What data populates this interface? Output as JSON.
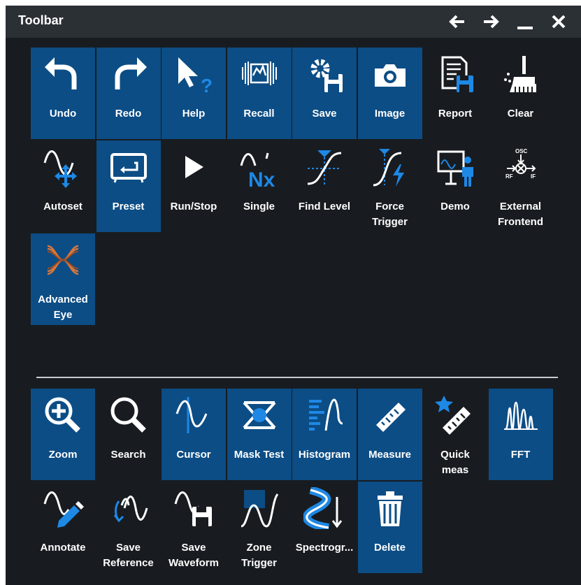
{
  "window": {
    "title": "Toolbar",
    "controls": [
      "arrow-left-icon",
      "arrow-right-icon",
      "minimize-icon",
      "close-icon"
    ]
  },
  "colors": {
    "background": "#181c20",
    "titlebar": "#2b3035",
    "selected": "#0c4d85",
    "accent": "#1e88e5",
    "text": "#ffffff"
  },
  "active_tools": [
    {
      "label": "Undo",
      "icon": "undo-icon",
      "selected": true
    },
    {
      "label": "Redo",
      "icon": "redo-icon",
      "selected": true
    },
    {
      "label": "Help",
      "icon": "help-icon",
      "selected": true
    },
    {
      "label": "Recall",
      "icon": "recall-icon",
      "selected": true
    },
    {
      "label": "Save",
      "icon": "save-settings-icon",
      "selected": true
    },
    {
      "label": "Image",
      "icon": "camera-icon",
      "selected": true
    },
    {
      "label": "Report",
      "icon": "report-icon",
      "selected": false
    },
    {
      "label": "Clear",
      "icon": "broom-icon",
      "selected": false
    },
    {
      "label": "Autoset",
      "icon": "autoset-icon",
      "selected": false
    },
    {
      "label": "Preset",
      "icon": "preset-icon",
      "selected": true
    },
    {
      "label": "Run/Stop",
      "icon": "play-icon",
      "selected": false
    },
    {
      "label": "Single",
      "icon": "single-nx-icon",
      "selected": false
    },
    {
      "label": "Find Level",
      "icon": "find-level-icon",
      "selected": false
    },
    {
      "label": "Force\nTrigger",
      "icon": "force-trigger-icon",
      "selected": false
    },
    {
      "label": "Demo",
      "icon": "demo-presenter-icon",
      "selected": false
    },
    {
      "label": "External\nFrontend",
      "icon": "mixer-icon",
      "selected": false
    },
    {
      "label": "Advanced\nEye",
      "icon": "eye-diagram-icon",
      "selected": true
    }
  ],
  "available_tools": [
    {
      "label": "Zoom",
      "icon": "zoom-in-icon",
      "selected": true
    },
    {
      "label": "Search",
      "icon": "search-icon",
      "selected": false
    },
    {
      "label": "Cursor",
      "icon": "cursor-icon",
      "selected": true
    },
    {
      "label": "Mask Test",
      "icon": "mask-test-icon",
      "selected": true
    },
    {
      "label": "Histogram",
      "icon": "histogram-icon",
      "selected": true
    },
    {
      "label": "Measure",
      "icon": "ruler-icon",
      "selected": true
    },
    {
      "label": "Quick\nmeas",
      "icon": "quick-measure-icon",
      "selected": false
    },
    {
      "label": "FFT",
      "icon": "fft-icon",
      "selected": true
    },
    {
      "label": "Annotate",
      "icon": "annotate-pen-icon",
      "selected": false
    },
    {
      "label": "Save\nReference",
      "icon": "save-reference-icon",
      "selected": false
    },
    {
      "label": "Save\nWaveform",
      "icon": "save-waveform-icon",
      "selected": false
    },
    {
      "label": "Zone\nTrigger",
      "icon": "zone-trigger-icon",
      "selected": false
    },
    {
      "label": "Spectrogr...",
      "icon": "spectrogram-icon",
      "selected": false
    },
    {
      "label": "Delete",
      "icon": "trash-icon",
      "selected": true
    }
  ],
  "ocx_labels": {
    "osc": "OSC",
    "rf": "RF",
    "if": "IF"
  }
}
